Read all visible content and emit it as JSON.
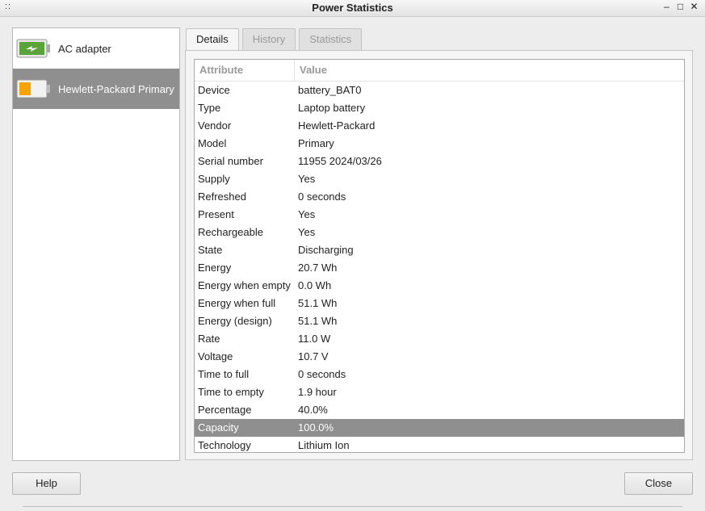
{
  "window": {
    "title": "Power Statistics",
    "menu_glyph": "::",
    "minimize_glyph": "‒",
    "maximize_glyph": "□",
    "close_glyph": "✕"
  },
  "sidebar": {
    "devices": [
      {
        "label": "AC adapter",
        "icon": "ac-adapter-icon",
        "selected": false
      },
      {
        "label": "Hewlett-Packard Primary",
        "icon": "battery-icon",
        "selected": true
      }
    ]
  },
  "tabs": [
    {
      "label": "Details",
      "active": true
    },
    {
      "label": "History",
      "active": false
    },
    {
      "label": "Statistics",
      "active": false
    }
  ],
  "details": {
    "headers": {
      "attribute": "Attribute",
      "value": "Value"
    },
    "rows": [
      {
        "attribute": "Device",
        "value": "battery_BAT0"
      },
      {
        "attribute": "Type",
        "value": "Laptop battery"
      },
      {
        "attribute": "Vendor",
        "value": "Hewlett-Packard"
      },
      {
        "attribute": "Model",
        "value": "Primary"
      },
      {
        "attribute": "Serial number",
        "value": "11955 2024/03/26"
      },
      {
        "attribute": "Supply",
        "value": "Yes"
      },
      {
        "attribute": "Refreshed",
        "value": "0 seconds"
      },
      {
        "attribute": "Present",
        "value": "Yes"
      },
      {
        "attribute": "Rechargeable",
        "value": "Yes"
      },
      {
        "attribute": "State",
        "value": "Discharging"
      },
      {
        "attribute": "Energy",
        "value": "20.7 Wh"
      },
      {
        "attribute": "Energy when empty",
        "value": "0.0 Wh"
      },
      {
        "attribute": "Energy when full",
        "value": "51.1 Wh"
      },
      {
        "attribute": "Energy (design)",
        "value": "51.1 Wh"
      },
      {
        "attribute": "Rate",
        "value": "11.0 W"
      },
      {
        "attribute": "Voltage",
        "value": "10.7 V"
      },
      {
        "attribute": "Time to full",
        "value": "0 seconds"
      },
      {
        "attribute": "Time to empty",
        "value": "1.9 hour"
      },
      {
        "attribute": "Percentage",
        "value": "40.0%"
      },
      {
        "attribute": "Capacity",
        "value": "100.0%",
        "selected": true
      },
      {
        "attribute": "Technology",
        "value": "Lithium Ion"
      }
    ]
  },
  "buttons": {
    "help": "Help",
    "close": "Close"
  },
  "colors": {
    "ac_green": "#5aa33a",
    "battery_orange": "#f5a300",
    "selection": "#8f8f8f"
  }
}
